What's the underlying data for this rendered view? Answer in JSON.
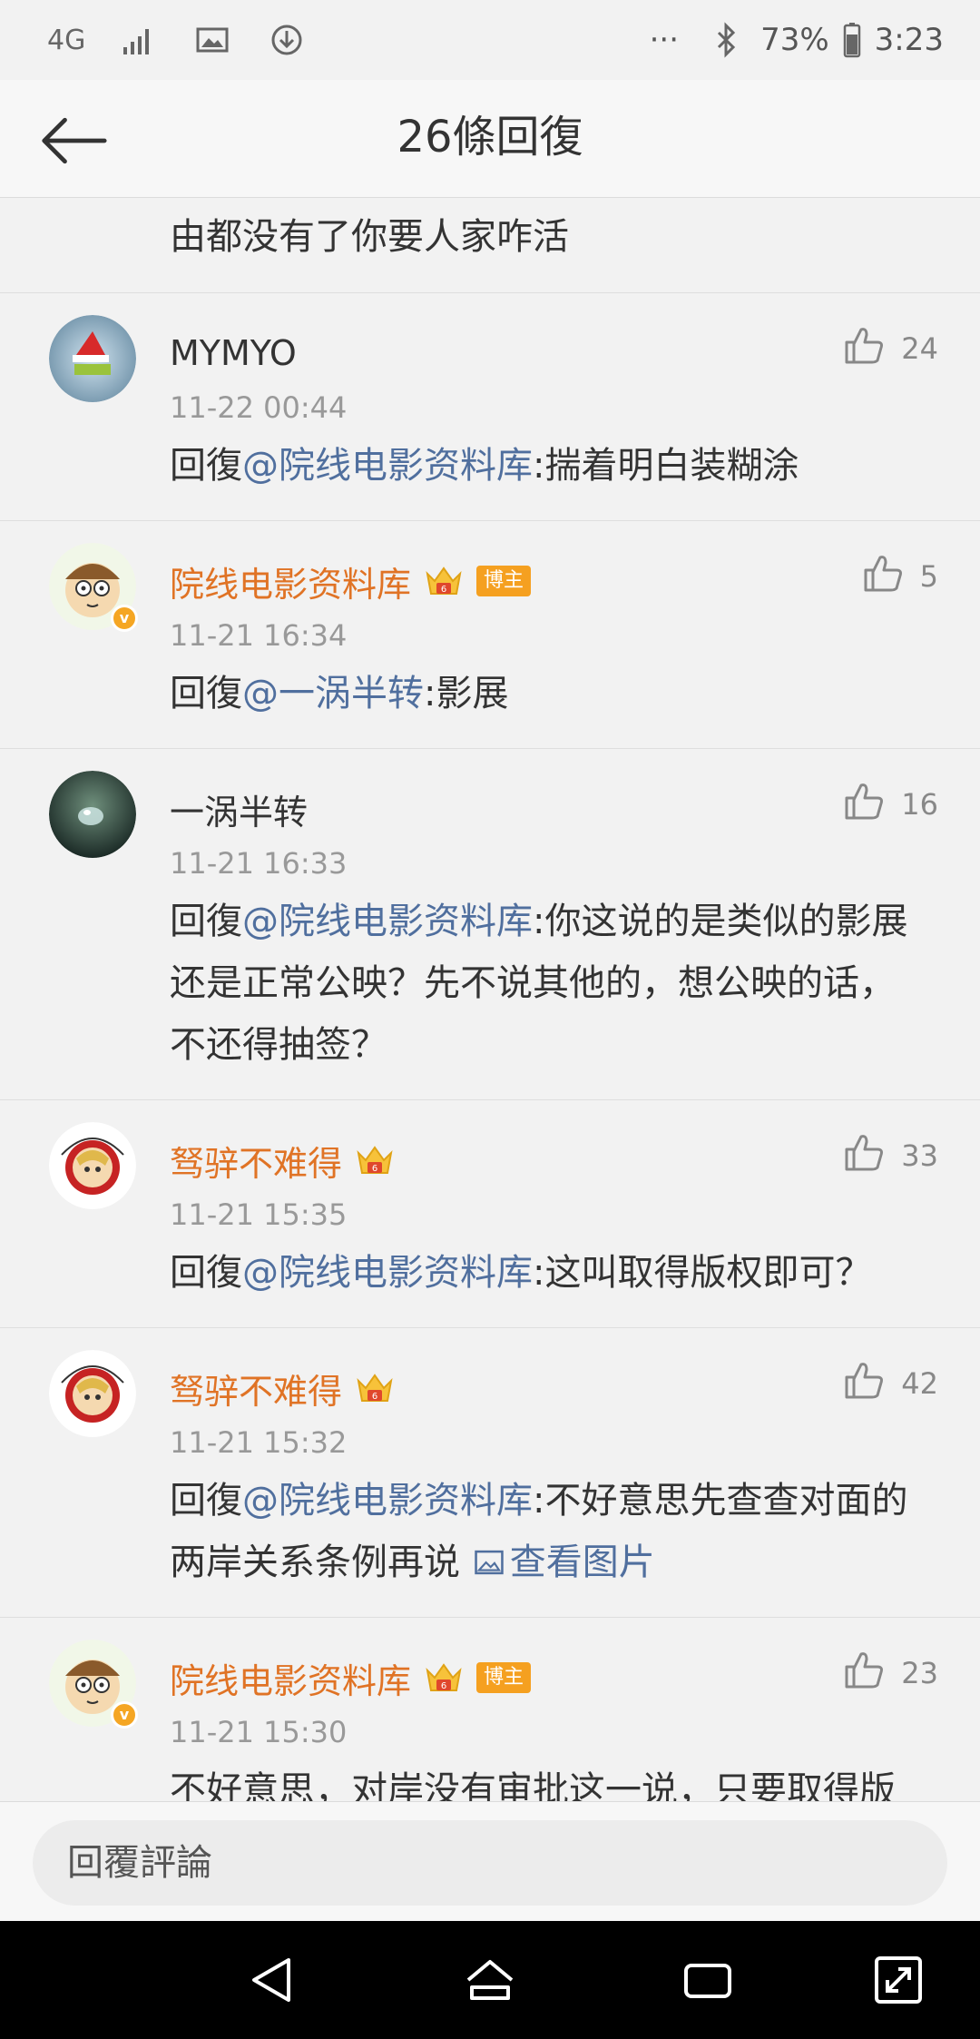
{
  "status_bar": {
    "network": "4G",
    "battery": "73%",
    "time": "3:23",
    "more": "···"
  },
  "header": {
    "title": "26條回復"
  },
  "partial_comment": {
    "text": "由都没有了你要人家咋活"
  },
  "comments": [
    {
      "username": "MYMYO",
      "name_color": "default",
      "vip": false,
      "blogger": false,
      "time": "11-22 00:44",
      "likes": "24",
      "reply_prefix": "回復",
      "mention": "@院线电影资料库",
      "text": ":揣着明白装糊涂"
    },
    {
      "username": "院线电影资料库",
      "name_color": "orange",
      "vip": true,
      "blogger": true,
      "blogger_label": "博主",
      "time": "11-21 16:34",
      "likes": "5",
      "reply_prefix": "回復",
      "mention": "@一涡半转",
      "text": ":影展"
    },
    {
      "username": "一涡半转",
      "name_color": "default",
      "vip": false,
      "blogger": false,
      "time": "11-21 16:33",
      "likes": "16",
      "reply_prefix": "回復",
      "mention": "@院线电影资料库",
      "text": ":你这说的是类似的影展还是正常公映？先不说其他的，想公映的话，不还得抽签？"
    },
    {
      "username": "驽骍不难得",
      "name_color": "orange",
      "vip": true,
      "blogger": false,
      "time": "11-21 15:35",
      "likes": "33",
      "reply_prefix": "回復",
      "mention": "@院线电影资料库",
      "text": ":这叫取得版权即可？"
    },
    {
      "username": "驽骍不难得",
      "name_color": "orange",
      "vip": true,
      "blogger": false,
      "time": "11-21 15:32",
      "likes": "42",
      "reply_prefix": "回復",
      "mention": "@院线电影资料库",
      "text": ":不好意思先查查对面的两岸关系条例再说 ",
      "image_link": "查看图片"
    },
    {
      "username": "院线电影资料库",
      "name_color": "orange",
      "vip": true,
      "blogger": true,
      "blogger_label": "博主",
      "time": "11-21 15:30",
      "likes": "23",
      "reply_prefix": "",
      "mention": "",
      "text": "不好意思，对岸没有审批这一说，只要取得版权即可。"
    }
  ],
  "reply_bar": {
    "placeholder": "回覆評論"
  },
  "colors": {
    "orange_name": "#e07325",
    "mention": "#506f9e",
    "background": "#f2f2f2"
  },
  "icons": {
    "back": "arrow-left-icon",
    "like": "thumb-up-icon",
    "crown": "vip-crown-icon",
    "image": "picture-icon"
  }
}
